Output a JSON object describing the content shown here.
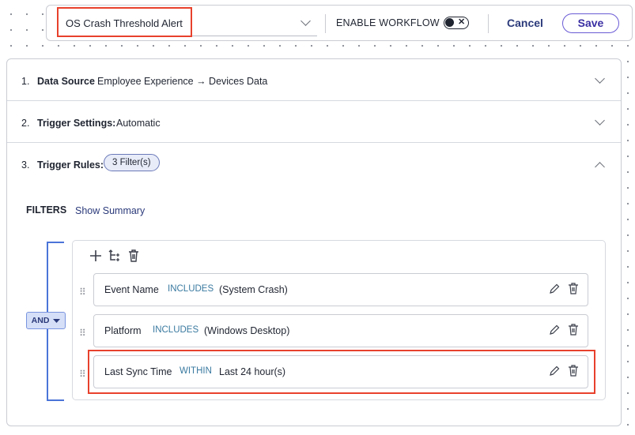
{
  "header": {
    "alert_name": "OS Crash Threshold Alert",
    "enable_workflow_label": "ENABLE WORKFLOW",
    "cancel_label": "Cancel",
    "save_label": "Save",
    "toggle_symbol": "✕"
  },
  "sections": [
    {
      "number": "1.",
      "label": "Data Source",
      "value": "Employee Experience → Devices Data"
    },
    {
      "number": "2.",
      "label": "Trigger Settings:",
      "value": "Automatic"
    },
    {
      "number": "3.",
      "label": "Trigger Rules:",
      "badge": "3 Filter(s)"
    }
  ],
  "filters": {
    "heading": "FILTERS",
    "show_summary": "Show Summary",
    "logic_operator": "AND",
    "rules": [
      {
        "field": "Event Name",
        "operator": "INCLUDES",
        "value": "(System Crash)"
      },
      {
        "field": "Platform",
        "operator": "INCLUDES",
        "value": "(Windows Desktop)"
      },
      {
        "field": "Last Sync Time",
        "operator": "WITHIN",
        "value": "Last 24 hour(s)"
      }
    ]
  },
  "colors": {
    "highlight": "#e8412c",
    "primary": "#2b3a7a",
    "save_border": "#6a5bd6",
    "bracket": "#4a74d8",
    "operator": "#3a7aa0"
  }
}
